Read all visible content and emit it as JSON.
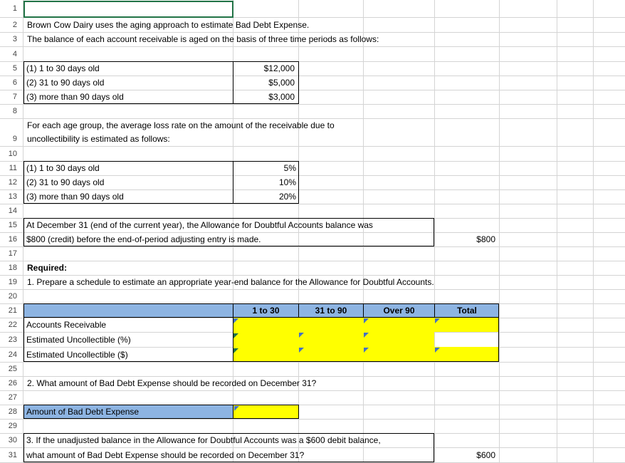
{
  "rows": [
    "1",
    "2",
    "3",
    "4",
    "5",
    "6",
    "7",
    "8",
    "9",
    "10",
    "11",
    "12",
    "13",
    "14",
    "15",
    "16",
    "17",
    "18",
    "19",
    "20",
    "21",
    "22",
    "23",
    "24",
    "25",
    "26",
    "27",
    "28",
    "29",
    "30",
    "31"
  ],
  "intro": {
    "line1": "Brown Cow Dairy uses the aging approach to estimate Bad Debt Expense.",
    "line2": "The balance of each account receivable is aged on the basis of three time periods as follows:"
  },
  "aging": [
    {
      "label": "(1) 1 to 30 days old",
      "value": "$12,000"
    },
    {
      "label": "(2) 31 to 90 days old",
      "value": "$5,000"
    },
    {
      "label": "(3) more than 90 days old",
      "value": "$3,000"
    }
  ],
  "rates_intro": {
    "line1": "For each age group, the average loss rate on the amount of the receivable due to",
    "line2": "uncollectibility is estimated as follows:"
  },
  "rates": [
    {
      "label": "(1) 1 to 30 days old",
      "value": "5%"
    },
    {
      "label": "(2) 31 to 90 days old",
      "value": "10%"
    },
    {
      "label": "(3) more than 90 days old",
      "value": "20%"
    }
  ],
  "allowance": {
    "line1": "At December 31 (end of the current year), the Allowance for Doubtful Accounts balance was",
    "line2": "$800 (credit) before the end-of-period adjusting entry is made.",
    "value": "$800"
  },
  "required": {
    "label": "Required:",
    "q1": "1. Prepare a schedule to estimate an appropriate year-end balance for the Allowance for Doubtful Accounts."
  },
  "schedule": {
    "headers": [
      "1 to 30",
      "31 to 90",
      "Over 90",
      "Total"
    ],
    "rows": [
      "Accounts Receivable",
      "Estimated Uncollectible (%)",
      "Estimated Uncollectible ($)"
    ]
  },
  "q2": {
    "text": "2. What amount of Bad Debt Expense should be recorded on December 31?",
    "answer_label": "Amount of Bad Debt Expense"
  },
  "q3": {
    "line1": "3. If the unadjusted balance in the Allowance for Doubtful Accounts was a $600 debit balance,",
    "line2": "what amount of Bad Debt Expense should be recorded on December 31?",
    "value": "$600"
  },
  "colors": {
    "input": "#ffff00",
    "header": "#8db4e2",
    "selection": "#217346"
  }
}
